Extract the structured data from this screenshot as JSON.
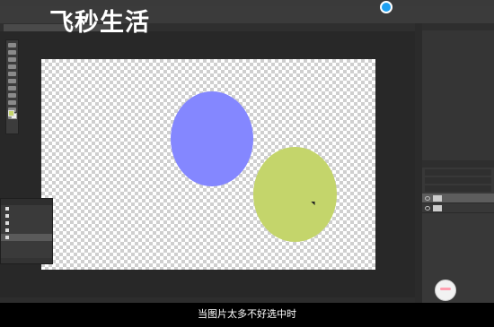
{
  "watermark": "飞秒生活",
  "canvas": {
    "shapes": [
      {
        "name": "blue-circle",
        "color": "#8487ff"
      },
      {
        "name": "green-circle",
        "color": "#c4d56b"
      }
    ]
  },
  "colors": {
    "foreground": "#c4d56b",
    "background": "#eeeeee"
  },
  "caption": "当图片太多不好选中时",
  "icons": [
    "move-icon",
    "marquee-icon",
    "lasso-icon",
    "crop-icon",
    "eyedropper-icon",
    "brush-icon",
    "eraser-icon",
    "text-icon",
    "pen-icon",
    "hand-icon",
    "zoom-icon",
    "eye-icon"
  ]
}
